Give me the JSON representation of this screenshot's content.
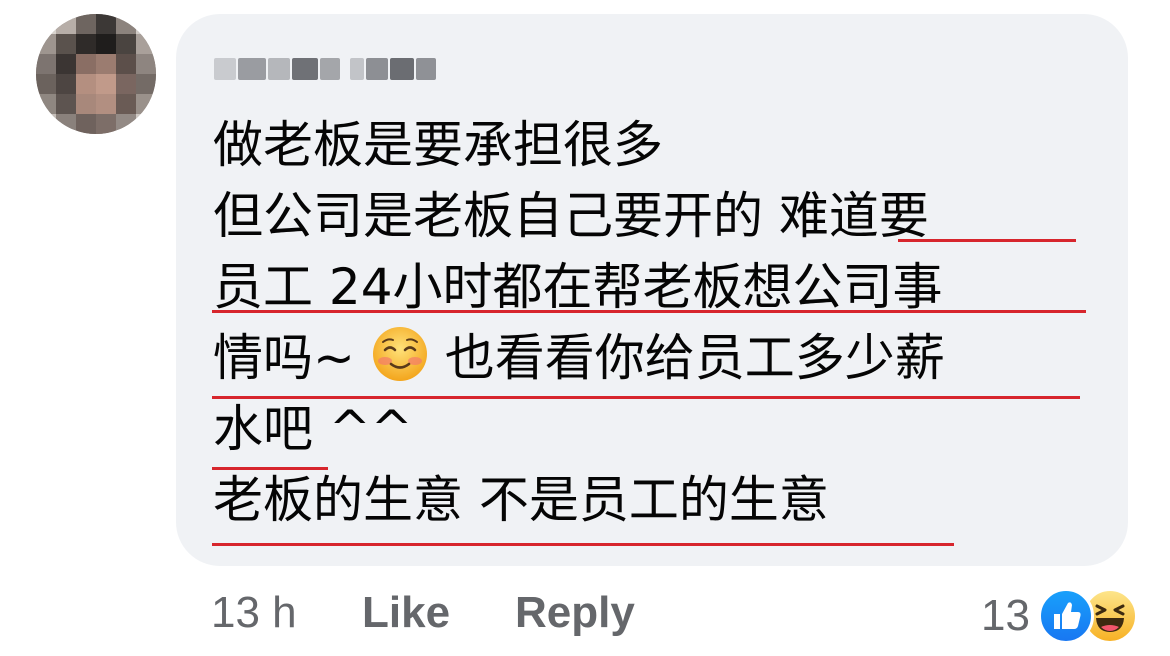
{
  "comment": {
    "lines": [
      "做老板是要承担很多",
      "但公司是老板自己要开的 难道要",
      "员工 24小时都在帮老板想公司事",
      "情吗~",
      "也看看你给员工多少薪",
      "水吧 ^^",
      "老板的生意 不是员工的生意"
    ]
  },
  "actions": {
    "timestamp": "13 h",
    "like_label": "Like",
    "reply_label": "Reply"
  },
  "reactions": {
    "count": "13",
    "icons": [
      "like-icon",
      "haha-icon"
    ],
    "like_color": "#1877f2",
    "haha_color": "#f7b125"
  },
  "colors": {
    "bubble_bg": "#f0f2f5",
    "underline": "#d7262d",
    "text": "#050505",
    "meta": "#65676b"
  }
}
